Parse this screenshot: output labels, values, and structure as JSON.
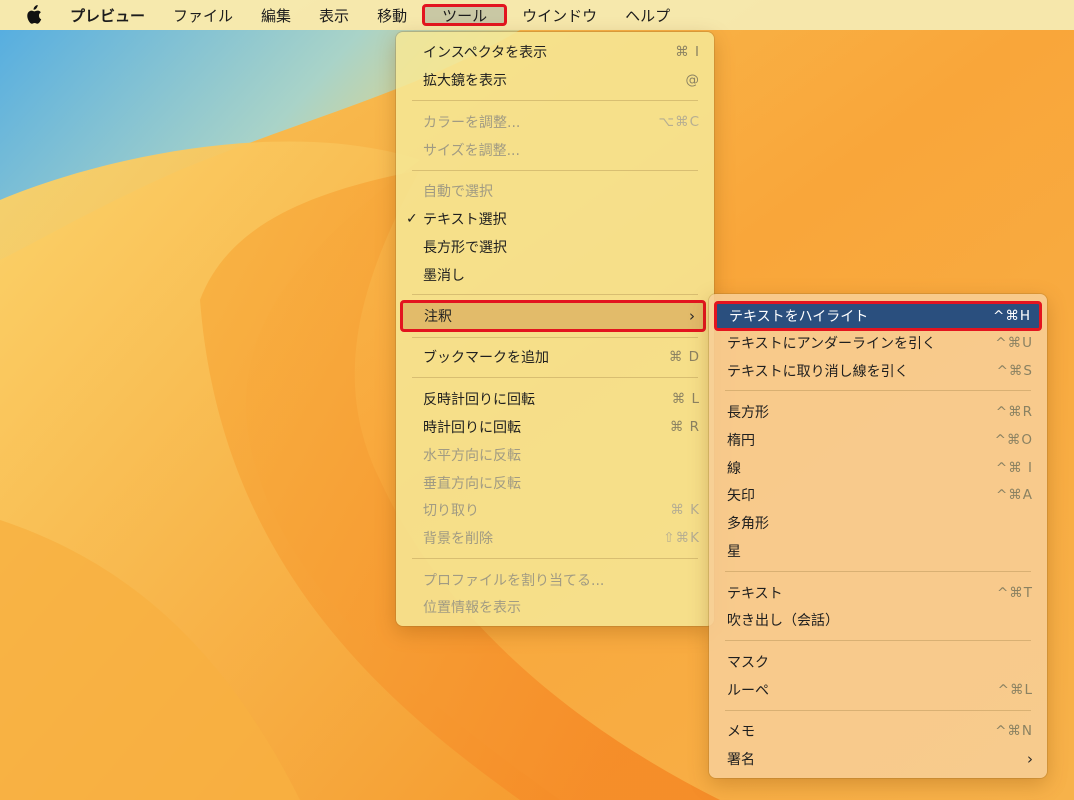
{
  "menubar": {
    "apple_icon": "apple-logo-icon",
    "app_name": "プレビュー",
    "items": [
      "ファイル",
      "編集",
      "表示",
      "移動",
      "ツール",
      "ウインドウ",
      "ヘルプ"
    ]
  },
  "tools_menu": {
    "items": [
      {
        "label": "インスペクタを表示",
        "shortcut": "⌘ I"
      },
      {
        "label": "拡大鏡を表示",
        "shortcut": "@"
      },
      {
        "label": "カラーを調整...",
        "shortcut": "⌥⌘C",
        "disabled": true
      },
      {
        "label": "サイズを調整...",
        "shortcut": "",
        "disabled": true
      },
      {
        "label": "自動で選択",
        "shortcut": "",
        "disabled": true
      },
      {
        "label": "テキスト選択",
        "shortcut": "",
        "checked": true,
        "check_mark": "✓"
      },
      {
        "label": "長方形で選択",
        "shortcut": ""
      },
      {
        "label": "墨消し",
        "shortcut": ""
      },
      {
        "label": "注釈",
        "shortcut": "",
        "submenu_arrow": "›"
      },
      {
        "label": "ブックマークを追加",
        "shortcut": "⌘ D"
      },
      {
        "label": "反時計回りに回転",
        "shortcut": "⌘ L"
      },
      {
        "label": "時計回りに回転",
        "shortcut": "⌘ R"
      },
      {
        "label": "水平方向に反転",
        "shortcut": "",
        "disabled": true
      },
      {
        "label": "垂直方向に反転",
        "shortcut": "",
        "disabled": true
      },
      {
        "label": "切り取り",
        "shortcut": "⌘ K",
        "disabled": true
      },
      {
        "label": "背景を削除",
        "shortcut": "⇧⌘K",
        "disabled": true
      },
      {
        "label": "プロファイルを割り当てる...",
        "shortcut": "",
        "disabled": true
      },
      {
        "label": "位置情報を表示",
        "shortcut": "",
        "disabled": true
      }
    ]
  },
  "annotate_submenu": {
    "items": [
      {
        "label": "テキストをハイライト",
        "shortcut": "^⌘H"
      },
      {
        "label": "テキストにアンダーラインを引く",
        "shortcut": "^⌘U"
      },
      {
        "label": "テキストに取り消し線を引く",
        "shortcut": "^⌘S"
      },
      {
        "label": "長方形",
        "shortcut": "^⌘R"
      },
      {
        "label": "楕円",
        "shortcut": "^⌘O"
      },
      {
        "label": "線",
        "shortcut": "^⌘ I"
      },
      {
        "label": "矢印",
        "shortcut": "^⌘A"
      },
      {
        "label": "多角形",
        "shortcut": ""
      },
      {
        "label": "星",
        "shortcut": ""
      },
      {
        "label": "テキスト",
        "shortcut": "^⌘T"
      },
      {
        "label": "吹き出し（会話）",
        "shortcut": ""
      },
      {
        "label": "マスク",
        "shortcut": ""
      },
      {
        "label": "ルーペ",
        "shortcut": "^⌘L"
      },
      {
        "label": "メモ",
        "shortcut": "^⌘N"
      },
      {
        "label": "署名",
        "shortcut": "",
        "submenu_arrow": "›"
      }
    ]
  },
  "colors": {
    "highlight_border": "#e3141f",
    "selected_item": "#2a4f7e",
    "hover_item": "#e2bb6a"
  }
}
